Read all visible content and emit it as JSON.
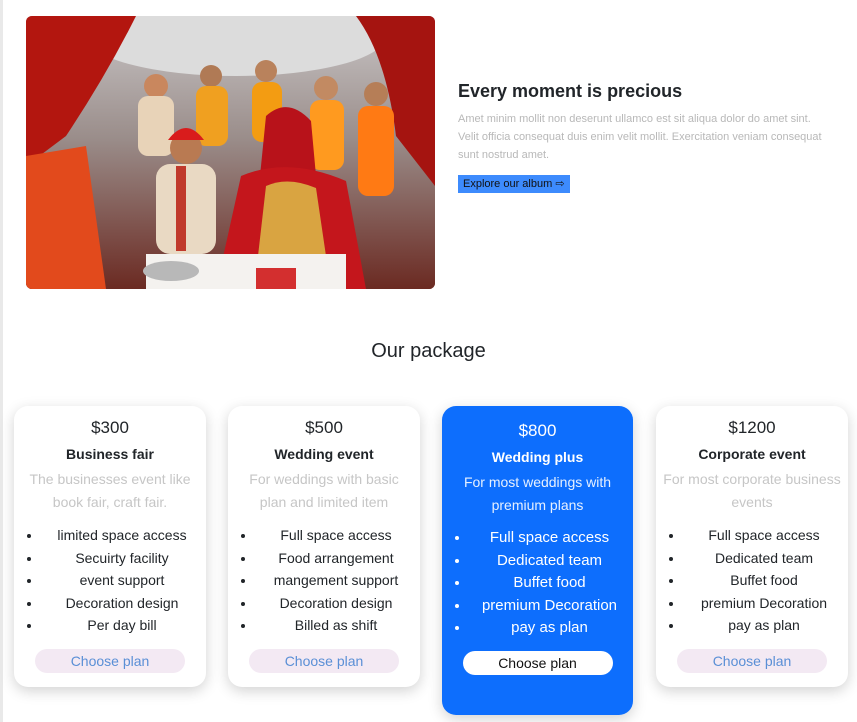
{
  "hero": {
    "image_alt": "wedding celebration photo",
    "title": "Every moment is precious",
    "body": "Amet minim mollit non deserunt ullamco est sit aliqua dolor do amet sint. Velit officia consequat duis enim velit mollit. Exercitation veniam consequat sunt nostrud amet.",
    "album_button": "Explore our album ⇨"
  },
  "packages": {
    "title": "Our package",
    "items": [
      {
        "price": "$300",
        "name": "Business fair",
        "description": "The businesses event like book fair, craft fair.",
        "features": [
          "limited space access",
          "Secuirty facility",
          "event support",
          "Decoration design",
          "Per day bill"
        ],
        "button": "Choose plan"
      },
      {
        "price": "$500",
        "name": "Wedding event",
        "description": "For weddings with basic plan and limited item",
        "features": [
          "Full space access",
          "Food arrangement",
          "mangement support",
          "Decoration design",
          "Billed as shift"
        ],
        "button": "Choose plan"
      },
      {
        "price": "$800",
        "name": "Wedding plus",
        "description": "For most weddings with premium plans",
        "features": [
          "Full space access",
          "Dedicated team",
          "Buffet food",
          "premium Decoration",
          "pay as plan"
        ],
        "button": "Choose plan"
      },
      {
        "price": "$1200",
        "name": "Corporate event",
        "description": "For most corporate business events",
        "features": [
          "Full space access",
          "Dedicated team",
          "Buffet food",
          "premium Decoration",
          "pay as plan"
        ],
        "button": "Choose plan"
      }
    ]
  },
  "colors": {
    "accent": "#0d6efd",
    "album_button": "#3d8bfd",
    "plan_button_bg": "#f3e9f3",
    "muted_text": "#c6c6c6"
  }
}
